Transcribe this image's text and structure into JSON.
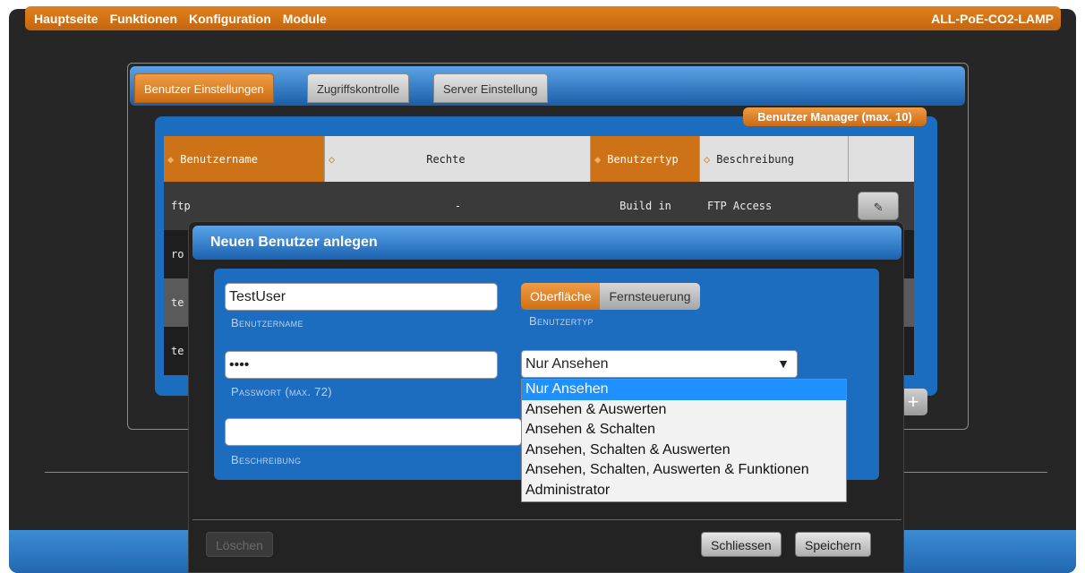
{
  "header": {
    "nav": [
      "Hauptseite",
      "Funktionen",
      "Konfiguration",
      "Module"
    ],
    "device_name": "ALL-PoE-CO2-LAMP"
  },
  "tabs": [
    "Benutzer Einstellungen",
    "Zugriffskontrolle",
    "Server Einstellung"
  ],
  "user_manager": {
    "badge": "Benutzer Manager (max. 10)",
    "columns": [
      "Benutzername",
      "Rechte",
      "Benutzertyp",
      "Beschreibung"
    ],
    "rows": [
      {
        "name": "ftp",
        "rights": "-",
        "type": "Build in",
        "desc": "FTP Access"
      },
      {
        "name": "ro",
        "rights": "",
        "type": "",
        "desc": ""
      },
      {
        "name": "te",
        "rights": "",
        "type": "",
        "desc": ""
      },
      {
        "name": "te",
        "rights": "",
        "type": "",
        "desc": ""
      }
    ]
  },
  "modal": {
    "title": "Neuen Benutzer anlegen",
    "username_value": "TestUser",
    "username_caption": "Benutzername",
    "password_value": "••••",
    "password_caption": "Passwort (max. 72)",
    "description_value": "",
    "description_caption": "Beschreibung",
    "usertype_options": [
      "Oberfläche",
      "Fernsteuerung"
    ],
    "usertype_caption": "Benutzertyp",
    "rights_selected": "Nur Ansehen",
    "rights_options": [
      "Nur Ansehen",
      "Ansehen & Auswerten",
      "Ansehen & Schalten",
      "Ansehen, Schalten & Auswerten",
      "Ansehen, Schalten, Auswerten & Funktionen",
      "Administrator"
    ],
    "delete_label": "Löschen",
    "close_label": "Schliessen",
    "save_label": "Speichern"
  },
  "icons": {
    "sort": "sort-icon",
    "edit": "pencil-icon",
    "add": "plus-icon",
    "dropdown": "caret-down-icon"
  },
  "colors": {
    "accent_orange": "#cd7216",
    "accent_blue": "#1a6dbf",
    "background": "#262626"
  }
}
